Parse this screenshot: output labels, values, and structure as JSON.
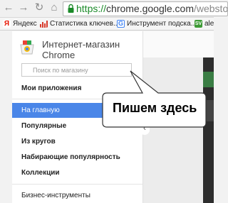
{
  "browser": {
    "url_scheme": "https://",
    "url_host": "chrome.google.com",
    "url_path": "/webstore/cate"
  },
  "bookmarks": [
    {
      "label": "Яндекс",
      "icon": "yandex-icon",
      "color": "#e61400"
    },
    {
      "label": "Статистика ключев...",
      "icon": "statistics-icon",
      "color": "#d83a2b"
    },
    {
      "label": "Инструмент подска...",
      "icon": "google-icon",
      "color": "#4285f4"
    },
    {
      "label": "ale",
      "icon": "sv-icon",
      "color": "#3d9b35"
    }
  ],
  "store": {
    "title": "Интернет-магазин Chrome",
    "search_placeholder": "Поиск по магазину"
  },
  "menu": {
    "my_apps": "Мои приложения",
    "items": [
      "На главную",
      "Популярные",
      "Из кругов",
      "Набирающие популярность",
      "Коллекции"
    ],
    "bottom": "Бизнес-инструменты"
  },
  "callout": {
    "text": "Пишем здесь"
  },
  "colors": {
    "active": "#4a86e8",
    "url_green": "#1a8a28"
  }
}
